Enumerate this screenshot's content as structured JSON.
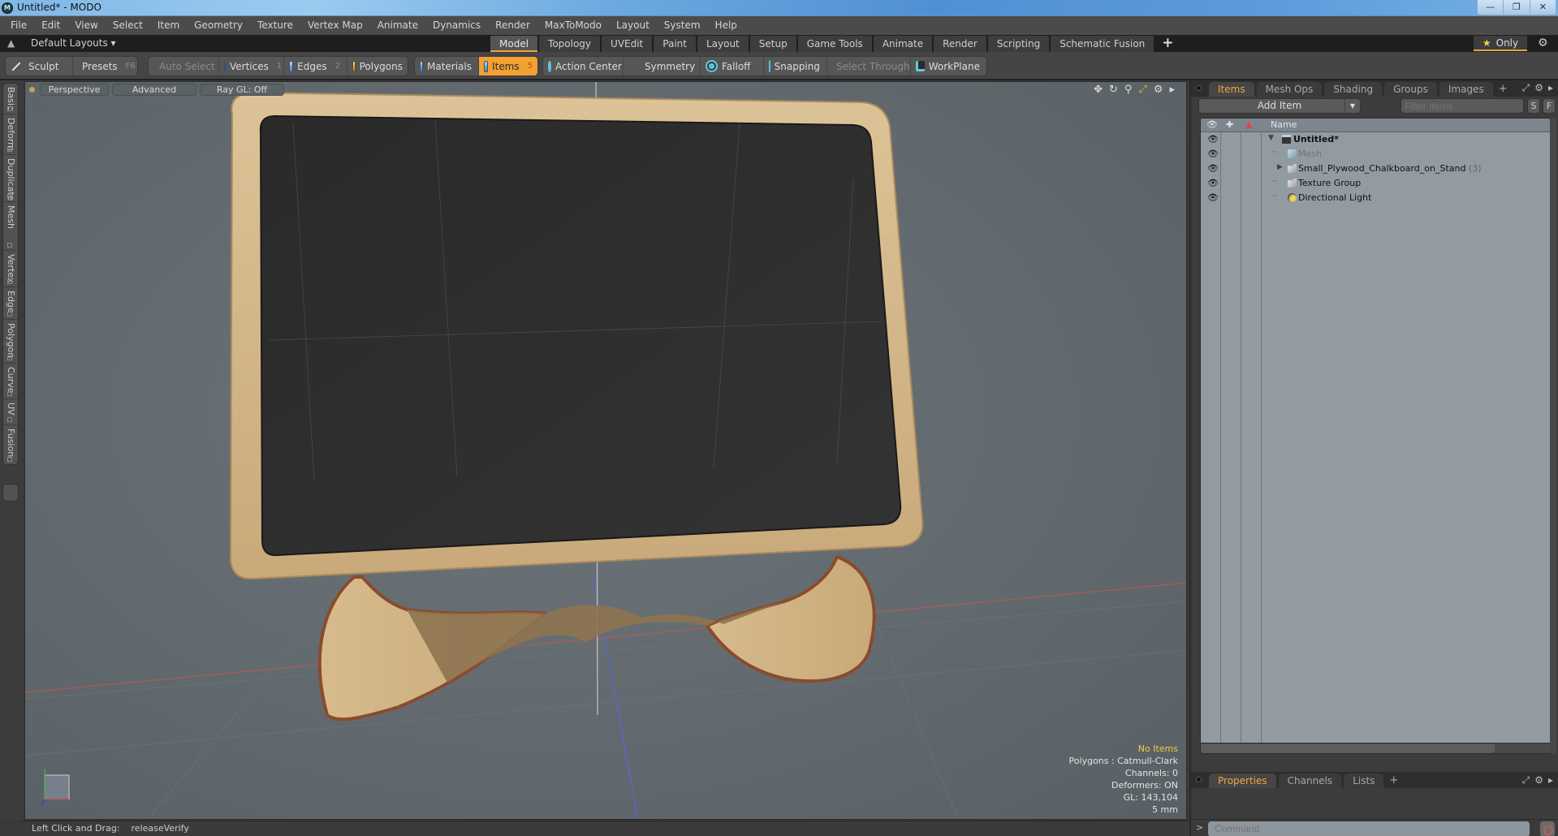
{
  "window": {
    "title": "Untitled* - MODO",
    "controls": [
      "minimize",
      "restore",
      "close"
    ]
  },
  "menu": [
    "File",
    "Edit",
    "View",
    "Select",
    "Item",
    "Geometry",
    "Texture",
    "Vertex Map",
    "Animate",
    "Dynamics",
    "Render",
    "MaxToModo",
    "Layout",
    "System",
    "Help"
  ],
  "layouts": {
    "label": "Default Layouts ▾",
    "tabs": [
      {
        "label": "Model",
        "active": true
      },
      {
        "label": "Topology"
      },
      {
        "label": "UVEdit"
      },
      {
        "label": "Paint"
      },
      {
        "label": "Layout"
      },
      {
        "label": "Setup"
      },
      {
        "label": "Game Tools"
      },
      {
        "label": "Animate"
      },
      {
        "label": "Render"
      },
      {
        "label": "Scripting"
      },
      {
        "label": "Schematic Fusion"
      }
    ],
    "add_tab": "+",
    "only_label": "Only"
  },
  "toolbar": {
    "sculpt": "Sculpt",
    "presets": "Presets",
    "presets_key": "F6",
    "auto_select": "Auto Select",
    "vertices": "Vertices",
    "vertices_key": "1",
    "edges": "Edges",
    "edges_key": "2",
    "polygons": "Polygons",
    "materials": "Materials",
    "items": "Items",
    "items_key": "5",
    "action_center": "Action Center",
    "symmetry": "Symmetry",
    "falloff": "Falloff",
    "snapping": "Snapping",
    "select_through": "Select Through",
    "workplane": "WorkPlane"
  },
  "left_tabs": [
    "Basic",
    "Deform",
    "Duplicate",
    "Mesh Edit",
    "Vertex",
    "Edge",
    "Polygon",
    "Curve",
    "UV",
    "Fusion"
  ],
  "viewport": {
    "view": "Perspective",
    "shading": "Advanced",
    "raygl": "Ray GL: Off",
    "stats": {
      "selection": "No Items",
      "polygons": "Polygons : Catmull-Clark",
      "channels": "Channels: 0",
      "deformers": "Deformers: ON",
      "gl": "GL: 143,104",
      "grid": "5 mm"
    },
    "axes": {
      "x": "X",
      "y": "Y",
      "z": "Z"
    }
  },
  "items_panel": {
    "tabs": [
      {
        "label": "Items",
        "active": true
      },
      {
        "label": "Mesh Ops"
      },
      {
        "label": "Shading"
      },
      {
        "label": "Groups"
      },
      {
        "label": "Images"
      }
    ],
    "add_tab": "+",
    "add_item": "Add Item",
    "filter_placeholder": "Filter Items",
    "s_btn": "S",
    "f_btn": "F",
    "column_name": "Name",
    "items": [
      {
        "name": "Untitled*",
        "type": "scene",
        "expanded": true
      },
      {
        "name": "Mesh",
        "type": "mesh",
        "dim": true
      },
      {
        "name": "Small_Plywood_Chalkboard_on_Stand",
        "count": "(3)",
        "type": "group",
        "collapsed": true
      },
      {
        "name": "Texture Group",
        "type": "group"
      },
      {
        "name": "Directional Light",
        "type": "light"
      }
    ]
  },
  "bottom_panel": {
    "tabs": [
      {
        "label": "Properties",
        "active": true
      },
      {
        "label": "Channels"
      },
      {
        "label": "Lists"
      }
    ],
    "add_tab": "+",
    "command_placeholder": "Command",
    "prompt": ">"
  },
  "statusbar": {
    "label": "Left Click and Drag:",
    "value": "releaseVerify"
  },
  "colors": {
    "accent": "#f2a132",
    "active_tab_text": "#f0a640",
    "viewport_bg": "#636b70",
    "chalkboard": "#2b2b2b",
    "plywood": "#d2b68a",
    "plywood_edge": "#8a4b2c"
  }
}
